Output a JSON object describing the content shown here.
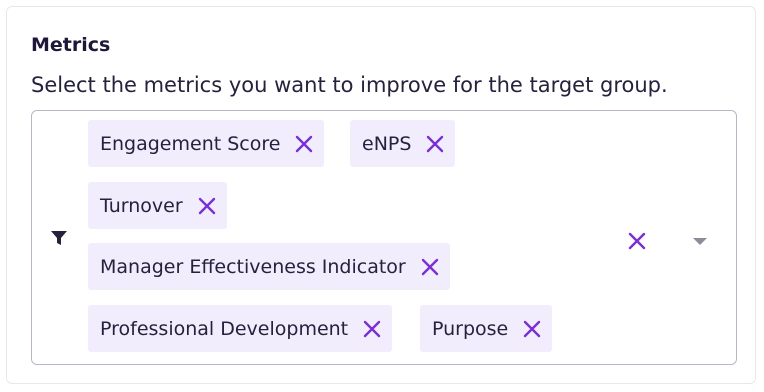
{
  "section": {
    "title": "Metrics",
    "description": "Select the metrics you want to improve for the target group."
  },
  "selector": {
    "icons": {
      "filter": "filter-icon",
      "remove": "close-icon",
      "clear": "clear-all-icon",
      "caret": "caret-down-icon"
    },
    "selected": [
      {
        "label": "Engagement Score"
      },
      {
        "label": "eNPS"
      },
      {
        "label": "Turnover"
      },
      {
        "label": "Manager Effectiveness Indicator"
      },
      {
        "label": "Professional Development"
      },
      {
        "label": "Purpose"
      }
    ]
  },
  "colors": {
    "accent": "#7a2fd4",
    "chip_bg": "#f1edfc",
    "border": "#b9b6c4",
    "text": "#27213d",
    "icon_gray": "#8f8b99"
  }
}
